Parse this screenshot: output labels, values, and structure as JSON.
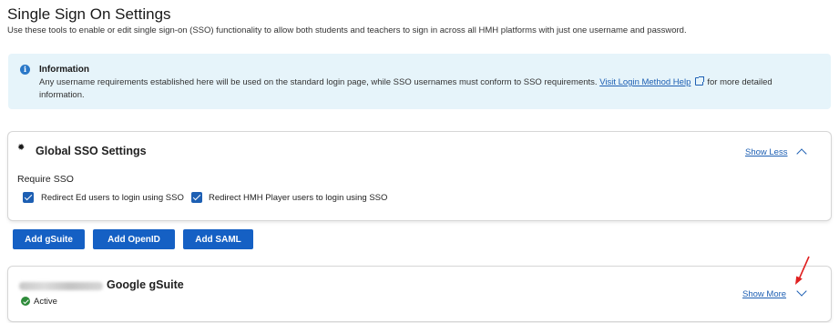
{
  "page": {
    "title": "Single Sign On Settings",
    "description": "Use these tools to enable or edit single sign-on (SSO) functionality to allow both students and teachers to sign in across all HMH platforms with just one username and password."
  },
  "info": {
    "title": "Information",
    "text_before": "Any username requirements established here will be used on the standard login page, while SSO usernames must conform to SSO requirements.",
    "link_label": "Visit Login Method Help",
    "text_after": "for more detailed information."
  },
  "global_sso": {
    "title": "Global SSO Settings",
    "toggle_label": "Show Less",
    "require_label": "Require SSO",
    "options": [
      {
        "label": "Redirect Ed users to login using SSO",
        "checked": true
      },
      {
        "label": "Redirect HMH Player users to login using SSO",
        "checked": true
      }
    ]
  },
  "actions": {
    "add_gsuite": "Add gSuite",
    "add_openid": "Add OpenID",
    "add_saml": "Add SAML"
  },
  "gsuite_card": {
    "title": "Google gSuite",
    "status": "Active",
    "toggle_label": "Show More"
  },
  "colors": {
    "accent": "#1560c4",
    "link": "#1d5fb3",
    "info_bg": "#e6f4fa",
    "active": "#2e8b3a",
    "annotation": "#e02020"
  }
}
